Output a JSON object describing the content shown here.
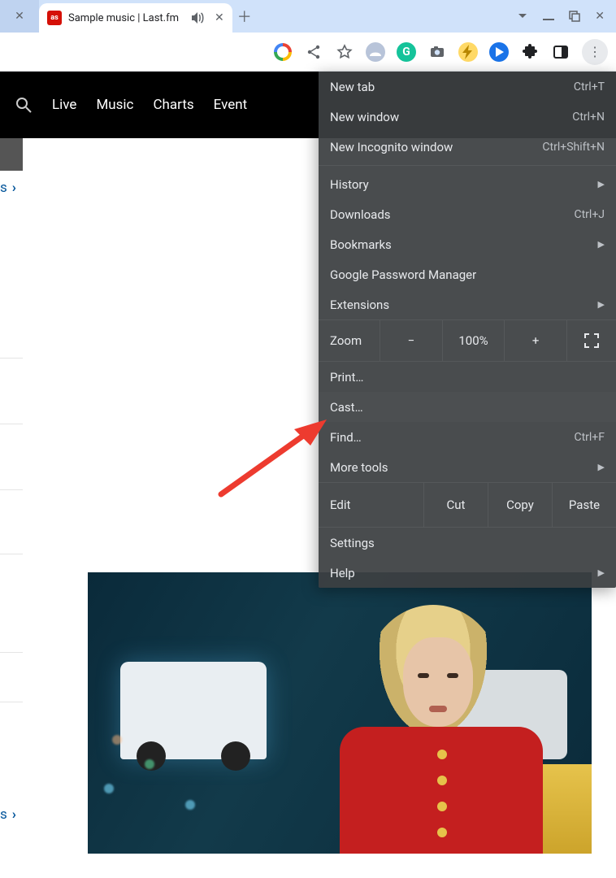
{
  "tab": {
    "title": "Sample music | Last.fm",
    "favicon_label": "as"
  },
  "nav": {
    "search_icon": "search",
    "items": [
      "Live",
      "Music",
      "Charts",
      "Event"
    ]
  },
  "left": {
    "link1": "s",
    "link2": "s"
  },
  "toolbar": {
    "icons": [
      "google",
      "share",
      "star",
      "vpn",
      "grammarly",
      "camera",
      "bolt",
      "play",
      "extensions",
      "side-panel",
      "menu"
    ]
  },
  "menu": {
    "new_tab": "New tab",
    "new_tab_sc": "Ctrl+T",
    "new_window": "New window",
    "new_window_sc": "Ctrl+N",
    "incognito": "New Incognito window",
    "incognito_sc": "Ctrl+Shift+N",
    "history": "History",
    "downloads": "Downloads",
    "downloads_sc": "Ctrl+J",
    "bookmarks": "Bookmarks",
    "gpm": "Google Password Manager",
    "extensions": "Extensions",
    "zoom_label": "Zoom",
    "zoom_minus": "−",
    "zoom_value": "100%",
    "zoom_plus": "+",
    "print": "Print…",
    "cast": "Cast…",
    "find": "Find…",
    "find_sc": "Ctrl+F",
    "more_tools": "More tools",
    "edit_label": "Edit",
    "cut": "Cut",
    "copy": "Copy",
    "paste": "Paste",
    "settings": "Settings",
    "help": "Help"
  }
}
